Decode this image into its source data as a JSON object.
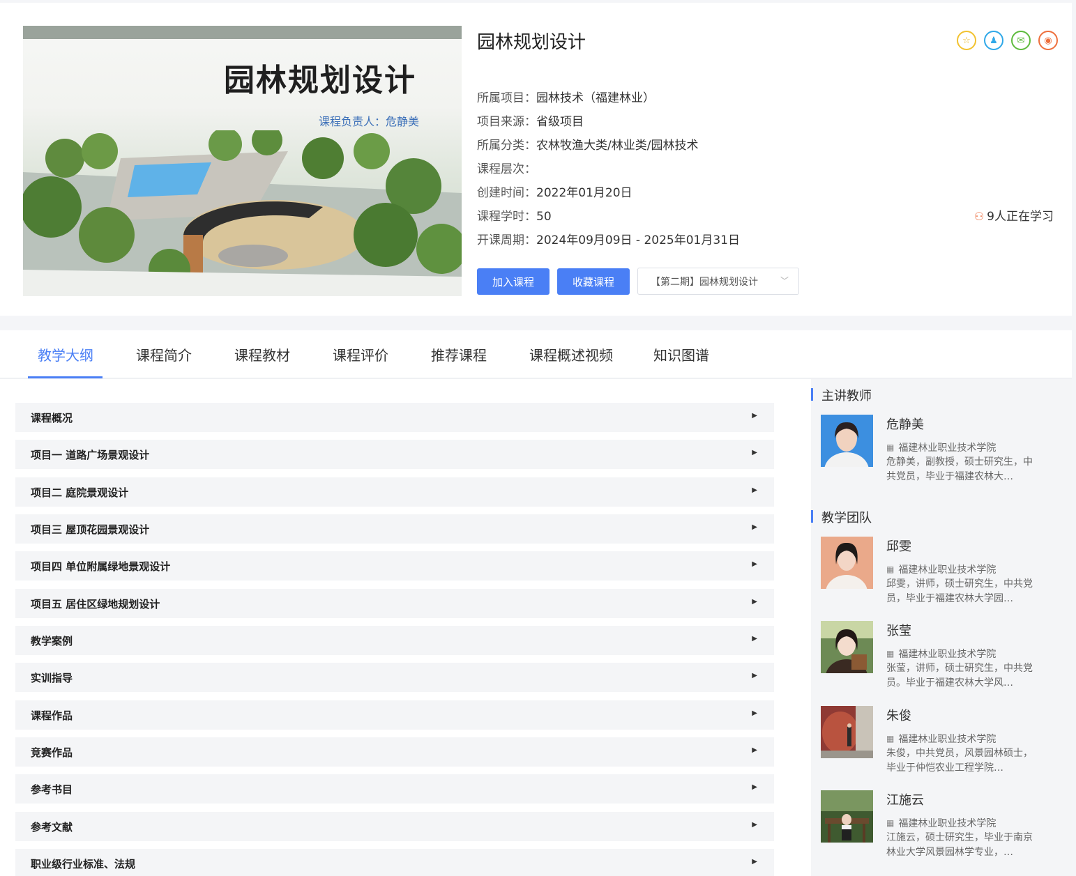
{
  "cover": {
    "title": "园林规划设计",
    "subtitle": "课程负责人：危静美"
  },
  "course": {
    "title": "园林规划设计",
    "info": [
      {
        "label": "所属项目：",
        "value": "园林技术（福建林业）"
      },
      {
        "label": "项目来源：",
        "value": "省级项目"
      },
      {
        "label": "所属分类：",
        "value": "农林牧渔大类/林业类/园林技术"
      },
      {
        "label": "课程层次：",
        "value": ""
      },
      {
        "label": "创建时间：",
        "value": "2022年01月20日"
      },
      {
        "label": "课程学时：",
        "value": "50"
      },
      {
        "label": "开课周期：",
        "value": "2024年09月09日 - 2025年01月31日"
      }
    ],
    "learning": "9人正在学习",
    "join_label": "加入课程",
    "fav_label": "收藏课程",
    "term": "【第二期】园林规划设计"
  },
  "share": [
    {
      "icon": "favorite-star-icon",
      "glyph": "☆"
    },
    {
      "icon": "qq-icon",
      "glyph": "♟"
    },
    {
      "icon": "wechat-icon",
      "glyph": "✉"
    },
    {
      "icon": "weibo-icon",
      "glyph": "◉"
    }
  ],
  "tabs": [
    "教学大纲",
    "课程简介",
    "课程教材",
    "课程评价",
    "推荐课程",
    "课程概述视频",
    "知识图谱"
  ],
  "chapters": [
    "课程概况",
    "项目一 道路广场景观设计",
    "项目二 庭院景观设计",
    "项目三 屋顶花园景观设计",
    "项目四 单位附属绿地景观设计",
    "项目五 居住区绿地规划设计",
    "教学案例",
    "实训指导",
    "课程作品",
    "竞赛作品",
    "参考书目",
    "参考文献",
    "职业级行业标准、法规"
  ],
  "sidebar": {
    "lead_title": "主讲教师",
    "team_title": "教学团队",
    "lead": {
      "name": "危静美",
      "school": "福建林业职业技术学院",
      "desc": "危静美，副教授，硕士研究生，中共党员，毕业于福建农林大…"
    },
    "team": [
      {
        "name": "邱雯",
        "school": "福建林业职业技术学院",
        "desc": "邱雯，讲师，硕士研究生，中共党员，毕业于福建农林大学园…"
      },
      {
        "name": "张莹",
        "school": "福建林业职业技术学院",
        "desc": "张莹，讲师，硕士研究生，中共党员。毕业于福建农林大学风…"
      },
      {
        "name": "朱俊",
        "school": "福建林业职业技术学院",
        "desc": "朱俊，中共党员，风景园林硕士，毕业于仲恺农业工程学院…"
      },
      {
        "name": "江施云",
        "school": "福建林业职业技术学院",
        "desc": "江施云，硕士研究生，毕业于南京林业大学风景园林学专业，…"
      }
    ]
  }
}
